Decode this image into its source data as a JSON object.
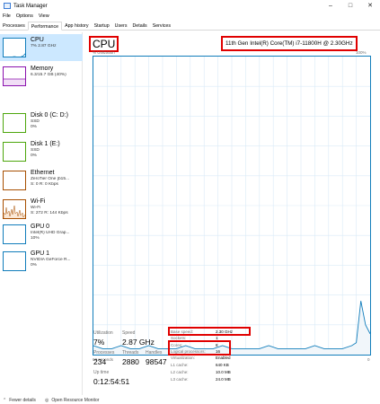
{
  "window": {
    "title": "Task Manager"
  },
  "menu": [
    "File",
    "Options",
    "View"
  ],
  "tabs": [
    "Processes",
    "Performance",
    "App history",
    "Startup",
    "Users",
    "Details",
    "Services"
  ],
  "sidebar": [
    {
      "title": "CPU",
      "sub1": "7% 2.87 GHz",
      "sub2": "",
      "color": "#117dbb"
    },
    {
      "title": "Memory",
      "sub1": "6.3/15.7 GB (40%)",
      "sub2": "",
      "color": "#8b12ae"
    },
    {
      "title": "Disk 0 (C: D:)",
      "sub1": "SSD",
      "sub2": "0%",
      "color": "#4da60c"
    },
    {
      "title": "Disk 1 (E:)",
      "sub1": "SSD",
      "sub2": "0%",
      "color": "#4da60c"
    },
    {
      "title": "Ethernet",
      "sub1": "ZeroTier One [b15...",
      "sub2": "S: 0 R: 0 Kbps",
      "color": "#a74f01"
    },
    {
      "title": "Wi-Fi",
      "sub1": "Wi-Fi",
      "sub2": "S: 272 R: 144 Kbps",
      "color": "#a74f01"
    },
    {
      "title": "GPU 0",
      "sub1": "Intel(R) UHD Grap...",
      "sub2": "10%",
      "color": "#117dbb"
    },
    {
      "title": "GPU 1",
      "sub1": "NVIDIA GeForce R...",
      "sub2": "0%",
      "color": "#117dbb"
    }
  ],
  "main": {
    "title": "CPU",
    "model": "11th Gen Intel(R) Core(TM) i7-11800H @ 2.30GHz",
    "chart_top_left": "% Utilization",
    "chart_top_right": "100%",
    "chart_bottom_left": "60 seconds",
    "chart_bottom_right": "0"
  },
  "stats": {
    "utilization_label": "Utilization",
    "utilization": "7%",
    "speed_label": "Speed",
    "speed": "2.87 GHz",
    "processes_label": "Processes",
    "processes": "234",
    "threads_label": "Threads",
    "threads": "2880",
    "handles_label": "Handles",
    "handles": "98547",
    "uptime_label": "Up time",
    "uptime": "0:12:54:51"
  },
  "details": [
    {
      "label": "Base speed:",
      "value": "2.30 GHz"
    },
    {
      "label": "Sockets:",
      "value": "1"
    },
    {
      "label": "Cores:",
      "value": "8"
    },
    {
      "label": "Logical processors:",
      "value": "16"
    },
    {
      "label": "Virtualization:",
      "value": "Enabled"
    },
    {
      "label": "L1 cache:",
      "value": "640 KB"
    },
    {
      "label": "L2 cache:",
      "value": "10.0 MB"
    },
    {
      "label": "L3 cache:",
      "value": "24.0 MB"
    }
  ],
  "footer": {
    "fewer": "Fewer details",
    "monitor": "Open Resource Monitor"
  },
  "chart_data": {
    "type": "area",
    "x": [
      0,
      2,
      4,
      6,
      8,
      10,
      12,
      14,
      16,
      18,
      20,
      22,
      24,
      26,
      28,
      30,
      32,
      34,
      36,
      38,
      40,
      42,
      44,
      46,
      48,
      50,
      52,
      54,
      56,
      57,
      58,
      59,
      60
    ],
    "values": [
      3,
      2,
      2,
      3,
      2,
      2,
      3,
      2,
      2,
      2,
      3,
      2,
      2,
      2,
      3,
      2,
      2,
      2,
      2,
      3,
      2,
      2,
      2,
      2,
      3,
      2,
      2,
      2,
      3,
      4,
      18,
      10,
      7
    ],
    "ylim": [
      0,
      100
    ],
    "color": "#117dbb"
  }
}
